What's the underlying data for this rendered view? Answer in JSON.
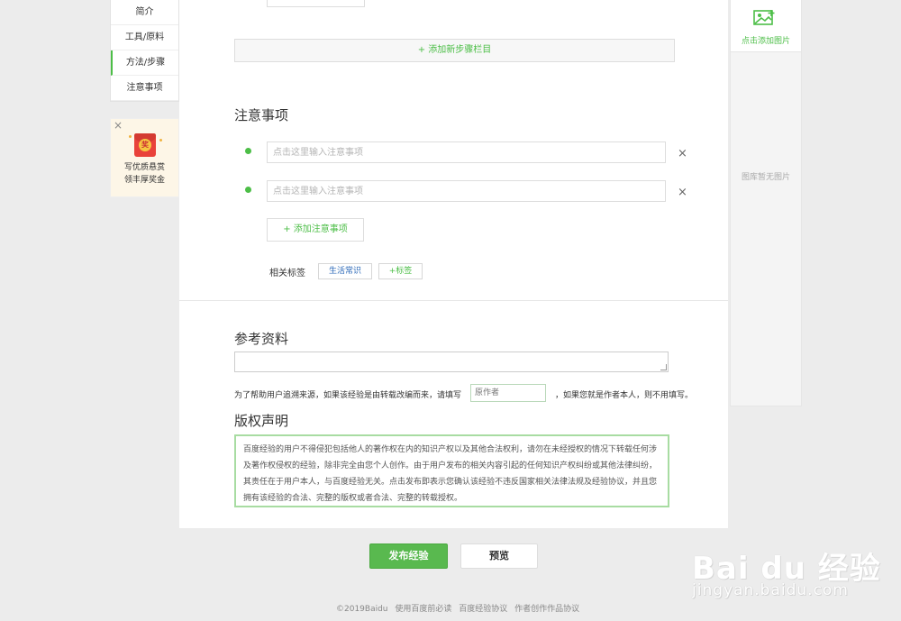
{
  "left_nav": {
    "items": [
      {
        "label": "简介"
      },
      {
        "label": "工具/原料"
      },
      {
        "label": "方法/步骤"
      },
      {
        "label": "注意事项"
      }
    ]
  },
  "promo": {
    "close": "×",
    "badge": "奖",
    "line1": "写优质悬赏",
    "line2": "领丰厚奖金"
  },
  "steps": {
    "add_step_label": "+ 添加新步骤栏目"
  },
  "notes": {
    "title": "注意事项",
    "inputs": [
      {
        "placeholder": "点击这里输入注意事项",
        "value": ""
      },
      {
        "placeholder": "点击这里输入注意事项",
        "value": ""
      }
    ],
    "remove": "×",
    "add_label": "+  添加注意事项",
    "tags_label": "相关标签",
    "tags": [
      "生活常识"
    ],
    "add_tag_label": "+标签"
  },
  "reference": {
    "title": "参考资料",
    "textarea_value": "",
    "source_prefix": "为了帮助用户追溯来源，如果该经验是由转载改编而来，请填写",
    "source_placeholder": "原作者",
    "source_suffix": "，如果您就是作者本人，则不用填写。"
  },
  "copyright": {
    "title": "版权声明",
    "text": "百度经验的用户不得侵犯包括他人的著作权在内的知识产权以及其他合法权利，请勿在未经授权的情况下转载任何涉及著作权侵权的经验，除非完全由您个人创作。由于用户发布的相关内容引起的任何知识产权纠纷或其他法律纠纷，其责任在于用户本人，与百度经验无关。点击发布即表示您确认该经验不违反国家相关法律法规及经验协议，并且您拥有该经验的合法、完整的版权或者合法、完整的转载授权。"
  },
  "right_panel": {
    "add_image_label": "点击添加图片",
    "empty_label": "图库暂无图片"
  },
  "actions": {
    "publish_label": "发布经验",
    "preview_label": "预览"
  },
  "footer": {
    "copyright": "©2019Baidu",
    "links": [
      "使用百度前必读",
      "百度经验协议",
      "作者创作作品协议"
    ]
  },
  "watermark": {
    "logo": "Bai du 经验",
    "url": "jingyan.baidu.com"
  },
  "colors": {
    "accent": "#4cbe47",
    "publish_bg": "#59b94f",
    "tag_blue": "#2d6ab8",
    "background": "#ececec"
  },
  "icons": {
    "image_add": "image-add-icon",
    "close": "close-icon",
    "bullet": "bullet-dot"
  }
}
